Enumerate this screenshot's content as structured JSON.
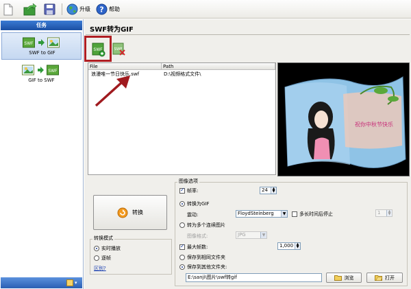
{
  "toolbar": {
    "upgrade_label": "升级",
    "help_label": "帮助"
  },
  "sidebar": {
    "header": "任务",
    "tasks": [
      {
        "label": "SWF to GIF",
        "from_badge": "SWF",
        "to_badge": ""
      },
      {
        "label": "GIF to SWF",
        "from_badge": "",
        "to_badge": "SWF"
      }
    ]
  },
  "main": {
    "title": "SWF转为GIF",
    "add_badge": "SWF",
    "remove_badge": "SWF",
    "table": {
      "columns": [
        "File",
        "Path"
      ],
      "rows": [
        {
          "file": "浪漫唯一节日快乐.swf",
          "path": "D:\\视频格式文件\\"
        }
      ]
    },
    "preview_caption": "祝你中秋节快乐"
  },
  "convert": {
    "label": "转换"
  },
  "mode": {
    "title": "转换模式",
    "options": [
      {
        "label": "实时播放",
        "checked": true
      },
      {
        "label": "逐帧",
        "checked": false
      }
    ],
    "diff_link": "区别?"
  },
  "image_options": {
    "title": "图像选项",
    "frame_rate": {
      "label": "帧率:",
      "checked": true,
      "value": "24"
    },
    "to_gif": {
      "label": "转换为GIF",
      "checked": true
    },
    "dither": {
      "label": "震动:",
      "value": "FloydSteinberg"
    },
    "long_time_stop": {
      "label": "多长时间后停止",
      "checked": false,
      "value": "1"
    },
    "to_images": {
      "label": "转为多个连续图片",
      "checked": false
    },
    "image_format": {
      "label": "图像格式:",
      "value": "JPG"
    },
    "max_frames": {
      "label": "最大帧数:",
      "checked": true,
      "value": "1,000"
    },
    "save_same_folder": {
      "label": "保存到相同文件夹",
      "checked": false
    },
    "save_other_folder": {
      "label": "保存到其他文件夹:",
      "checked": true
    },
    "output_path": "E:\\sanji\\图片\\swf转gif",
    "browse_label": "浏览",
    "open_label": "打开"
  },
  "colors": {
    "highlight_box": "#b01e23",
    "arrow": "#a01a1f",
    "header_blue": "#2a61bd"
  }
}
